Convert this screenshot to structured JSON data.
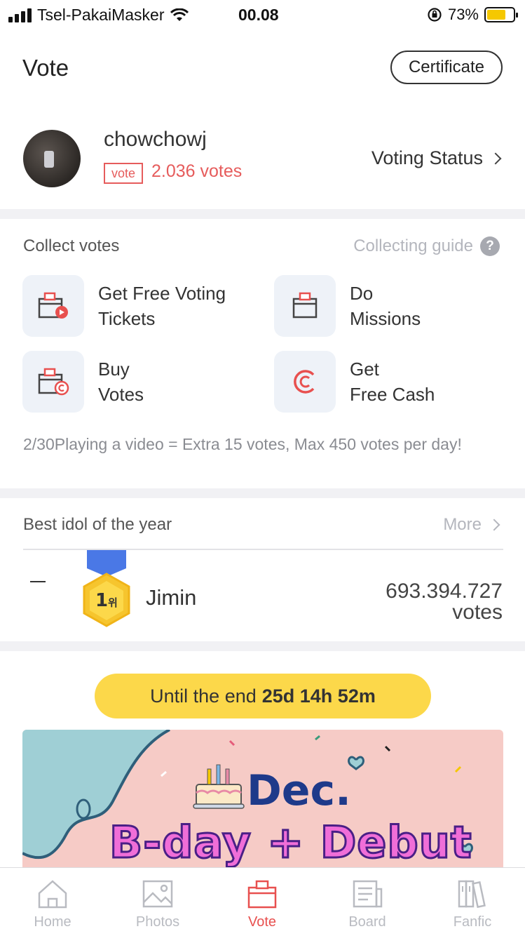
{
  "status_bar": {
    "carrier": "Tsel-PakaiMasker",
    "time": "00.08",
    "battery": "73%",
    "battery_level": 0.73,
    "icons": [
      "signal-icon",
      "wifi-icon",
      "rotation-lock-icon",
      "battery-icon"
    ]
  },
  "header": {
    "title": "Vote",
    "certificate_label": "Certificate"
  },
  "profile": {
    "username": "chowchowj",
    "vote_tag": "vote",
    "votes": "2.036 votes",
    "voting_status_label": "Voting Status"
  },
  "collect": {
    "title": "Collect votes",
    "guide_label": "Collecting guide",
    "guide_icon": "question-icon",
    "tiles": [
      {
        "label": "Get Free Voting\nTickets",
        "icon": "ticket-play-icon"
      },
      {
        "label": "Do\nMissions",
        "icon": "ticket-icon"
      },
      {
        "label": "Buy\nVotes",
        "icon": "ticket-coin-icon"
      },
      {
        "label": "Get\nFree Cash",
        "icon": "cash-icon"
      }
    ],
    "note": "2/30Playing a video = Extra 15 votes, Max 450 votes per day!"
  },
  "ranking": {
    "title": "Best idol of the year",
    "more_label": "More",
    "entries": [
      {
        "change": "—",
        "rank": "1",
        "rank_suffix": "위",
        "name": "Jimin",
        "votes": "693.394.727",
        "votes_unit": "votes"
      }
    ]
  },
  "countdown": {
    "prefix": "Until the end",
    "time": "25d 14h 52m"
  },
  "banner": {
    "line1": "Dec.",
    "line2": "B-day + Debut"
  },
  "colors": {
    "accent": "#e8504f",
    "countdown_bg": "#fcd84a",
    "banner_bg": "#f6cbc6"
  },
  "tabs": [
    {
      "label": "Home",
      "icon": "home-icon",
      "active": false
    },
    {
      "label": "Photos",
      "icon": "photos-icon",
      "active": false
    },
    {
      "label": "Vote",
      "icon": "vote-icon",
      "active": true
    },
    {
      "label": "Board",
      "icon": "board-icon",
      "active": false
    },
    {
      "label": "Fanfic",
      "icon": "fanfic-icon",
      "active": false
    }
  ]
}
